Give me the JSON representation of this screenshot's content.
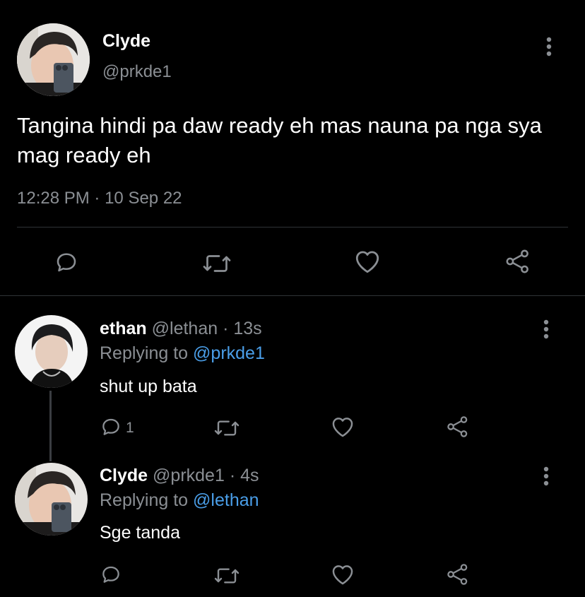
{
  "main_tweet": {
    "name": "Clyde",
    "handle": "@prkde1",
    "text": "Tangina hindi pa daw ready eh mas nauna pa nga sya mag ready eh",
    "time": "12:28 PM",
    "sep": "·",
    "date": "10 Sep 22"
  },
  "replies": [
    {
      "name": "ethan",
      "handle": "@lethan",
      "sep": "·",
      "age": "13s",
      "replying_prefix": "Replying to",
      "replying_to": "@prkde1",
      "text": "shut up bata",
      "reply_count": "1"
    },
    {
      "name": "Clyde",
      "handle": "@prkde1",
      "sep": "·",
      "age": "4s",
      "replying_prefix": "Replying to",
      "replying_to": "@lethan",
      "text": "Sge tanda"
    }
  ],
  "colors": {
    "background": "#000000",
    "text": "#ffffff",
    "secondary": "#8b8f94",
    "mention": "#4a9ee8",
    "divider": "#2f3336"
  },
  "icons": [
    "more-icon",
    "reply-icon",
    "retweet-icon",
    "like-icon",
    "share-icon"
  ]
}
